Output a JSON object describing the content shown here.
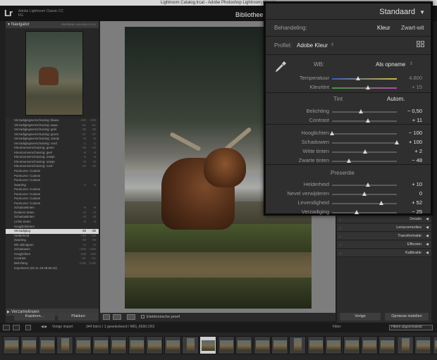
{
  "window_title": "Lightroom Catalog.lrcat - Adobe Photoshop Lightroom Classic",
  "app": {
    "logo": "Lr",
    "logo_sub1": "Adobe Lightroom Classic CC",
    "logo_sub2": "FG",
    "module": "Bibliotheek"
  },
  "navigator": {
    "title": "Navigator",
    "options": "PASSEND  VULLEN  1:1  3:1"
  },
  "history": [
    {
      "label": "Verzadigingsverschuiving: blauw",
      "v1": "-100",
      "v2": "-100"
    },
    {
      "label": "Verzadigingsverschuiving: aqua",
      "v1": "-61",
      "v2": "-61"
    },
    {
      "label": "Verzadigingsverschuiving: geel",
      "v1": "-25",
      "v2": "-25"
    },
    {
      "label": "Verzadigingsverschuiving: groen",
      "v1": "-47",
      "v2": "-47"
    },
    {
      "label": "Verzadigingsverschuiving: oranje",
      "v1": "+5",
      "v2": "+5"
    },
    {
      "label": "Verzadigingsverschuiving: rood",
      "v1": "-1",
      "v2": "-1"
    },
    {
      "label": "Kleurtoonverschuiving: groen",
      "v1": "-15",
      "v2": "-15"
    },
    {
      "label": "Kleurtoonverschuiving: geel",
      "v1": "-8",
      "v2": "-8"
    },
    {
      "label": "Kleurtoonverschuiving: oranje",
      "v1": "-5",
      "v2": "-5"
    },
    {
      "label": "Kleurtoonverschuiving: oranje",
      "v1": "+5",
      "v2": "+5"
    },
    {
      "label": "Kleurtoonverschuiving: rood",
      "v1": "-10",
      "v2": "-10"
    },
    {
      "label": "Puntcurve: Custom",
      "v1": "",
      "v2": ""
    },
    {
      "label": "Puntcurve: Custom",
      "v1": "",
      "v2": ""
    },
    {
      "label": "Puntcurve: Custom",
      "v1": "",
      "v2": ""
    },
    {
      "label": "Zwarting",
      "v1": "-4",
      "v2": "-4"
    },
    {
      "label": "Puntcurve: Custom",
      "v1": "",
      "v2": ""
    },
    {
      "label": "Puntcurve: Custom",
      "v1": "",
      "v2": ""
    },
    {
      "label": "Puntcurve: Custom",
      "v1": "",
      "v2": ""
    },
    {
      "label": "Puntcurve: Custom",
      "v1": "",
      "v2": ""
    },
    {
      "label": "Schaduwtinten",
      "v1": "-8",
      "v2": "-8"
    },
    {
      "label": "Donkere tinten",
      "v1": "+3",
      "v2": "+3"
    },
    {
      "label": "Schaduwtinten",
      "v1": "+8",
      "v2": "+8"
    },
    {
      "label": "Lichte tinten",
      "v1": "-6",
      "v2": "-6"
    },
    {
      "label": "Hooglichttinten",
      "v1": "",
      "v2": ""
    },
    {
      "label": "Verzadiging",
      "v1": "-25",
      "v2": "-25",
      "selected": true
    },
    {
      "label": "Helderheid",
      "v1": "+10",
      "v2": "+10"
    },
    {
      "label": "Zwarting",
      "v1": "-48",
      "v2": "-48"
    },
    {
      "label": "Wit uitknippen",
      "v1": "+2",
      "v2": "+2"
    },
    {
      "label": "Schaduwen",
      "v1": "+100",
      "v2": "+100"
    },
    {
      "label": "Hooglichten",
      "v1": "-100",
      "v2": "-100"
    },
    {
      "label": "Contrast",
      "v1": "+11",
      "v2": "+11"
    },
    {
      "label": "Belichting",
      "v1": "-0,50",
      "v2": "-0,50"
    },
    {
      "label": "Importeren (20-11-19 08:50:22)",
      "v1": "",
      "v2": ""
    }
  ],
  "collections": {
    "title": "Verzamelingen"
  },
  "left_buttons": {
    "copy": "Kopiëren...",
    "paste": "Plakken"
  },
  "toolbar": {
    "soft_proof": "Elektronische proef"
  },
  "right_sections": [
    {
      "label": "Details"
    },
    {
      "label": "Lenscorrecties"
    },
    {
      "label": "Transformatie"
    },
    {
      "label": "Effecten"
    },
    {
      "label": "Kalibratie"
    }
  ],
  "right_buttons": {
    "previous": "Vorige",
    "reset": "Opnieuw instellen"
  },
  "basic_panel": {
    "title": "Standaard",
    "treatment_label": "Behandeling:",
    "treatment_color": "Kleur",
    "treatment_bw": "Zwart-wit",
    "profile_label": "Profiel:",
    "profile_value": "Adobe Kleur",
    "wb_label": "WB:",
    "wb_value": "Als opname",
    "tone_label": "Tint",
    "tone_auto": "Autom.",
    "presence_label": "Presentie",
    "sliders": {
      "temperature": {
        "label": "Temperatuur",
        "value": "4.800",
        "position": 0.4,
        "dim": true
      },
      "tint": {
        "label": "Kleurtint",
        "value": "+ 15",
        "position": 0.55,
        "dim": true
      },
      "exposure": {
        "label": "Belichting",
        "value": "− 0,50",
        "position": 0.45
      },
      "contrast": {
        "label": "Contrast",
        "value": "+ 11",
        "position": 0.55
      },
      "highlights": {
        "label": "Hooglichten",
        "value": "− 100",
        "position": 0.0
      },
      "shadows": {
        "label": "Schaduwen",
        "value": "+ 100",
        "position": 1.0
      },
      "whites": {
        "label": "Witte tinten",
        "value": "+ 2",
        "position": 0.51
      },
      "blacks": {
        "label": "Zwarte tinten",
        "value": "− 48",
        "position": 0.26
      },
      "clarity": {
        "label": "Helderheid",
        "value": "+ 10",
        "position": 0.55
      },
      "dehaze": {
        "label": "Nevel verwijderen",
        "value": "0",
        "position": 0.5
      },
      "vibrance": {
        "label": "Levendigheid",
        "value": "+ 52",
        "position": 0.76
      },
      "saturation": {
        "label": "Verzadiging",
        "value": "− 25",
        "position": 0.38
      }
    }
  },
  "filmbar": {
    "source": "Vorige import",
    "count": "344 foto's / 1 geselecteerd / IMG_6690.CR2",
    "filter_label": "Filter:",
    "filter_value": "Filters uitgeschakeld"
  }
}
